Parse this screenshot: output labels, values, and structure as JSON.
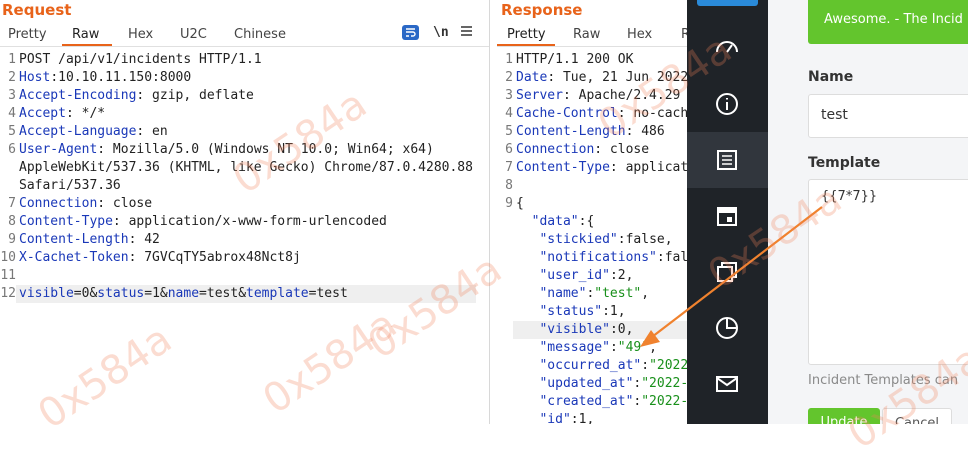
{
  "request": {
    "title": "Request",
    "tabs": [
      "Pretty",
      "Raw",
      "Hex",
      "U2C",
      "Chinese"
    ],
    "active_tab": "Raw",
    "icons": [
      "wrap-icon",
      "newline-icon",
      "menu-icon"
    ],
    "newline_label": "\\n",
    "lines": [
      {
        "n": "1",
        "parts": [
          [
            "p",
            "POST /api/v1/incidents HTTP/1.1"
          ]
        ]
      },
      {
        "n": "2",
        "parts": [
          [
            "k",
            "Host"
          ],
          [
            "p",
            ":10.10.11.150:8000"
          ]
        ]
      },
      {
        "n": "3",
        "parts": [
          [
            "k",
            "Accept-Encoding"
          ],
          [
            "p",
            ": gzip, deflate"
          ]
        ]
      },
      {
        "n": "4",
        "parts": [
          [
            "k",
            "Accept"
          ],
          [
            "p",
            ": */*"
          ]
        ]
      },
      {
        "n": "5",
        "parts": [
          [
            "k",
            "Accept-Language"
          ],
          [
            "p",
            ": en"
          ]
        ]
      },
      {
        "n": "6",
        "parts": [
          [
            "k",
            "User-Agent"
          ],
          [
            "p",
            ": Mozilla/5.0 (Windows NT 10.0; Win64; x64)"
          ]
        ]
      },
      {
        "n": "",
        "parts": [
          [
            "p",
            "AppleWebKit/537.36 (KHTML, like Gecko) Chrome/87.0.4280.88"
          ]
        ]
      },
      {
        "n": "",
        "parts": [
          [
            "p",
            "Safari/537.36"
          ]
        ]
      },
      {
        "n": "7",
        "parts": [
          [
            "k",
            "Connection"
          ],
          [
            "p",
            ": close"
          ]
        ]
      },
      {
        "n": "8",
        "parts": [
          [
            "k",
            "Content-Type"
          ],
          [
            "p",
            ": application/x-www-form-urlencoded"
          ]
        ]
      },
      {
        "n": "9",
        "parts": [
          [
            "k",
            "Content-Length"
          ],
          [
            "p",
            ": 42"
          ]
        ]
      },
      {
        "n": "10",
        "parts": [
          [
            "k",
            "X-Cachet-Token"
          ],
          [
            "p",
            ": 7GVCqTY5abrox48Nct8j"
          ]
        ]
      },
      {
        "n": "11",
        "parts": []
      },
      {
        "n": "12",
        "parts": [
          [
            "k",
            "visible"
          ],
          [
            "p",
            "="
          ],
          [
            "p",
            "0"
          ],
          [
            "p",
            "&"
          ],
          [
            "k",
            "status"
          ],
          [
            "p",
            "="
          ],
          [
            "p",
            "1"
          ],
          [
            "p",
            "&"
          ],
          [
            "k",
            "name"
          ],
          [
            "p",
            "="
          ],
          [
            "p",
            "test"
          ],
          [
            "p",
            "&"
          ],
          [
            "k",
            "template"
          ],
          [
            "p",
            "="
          ],
          [
            "p",
            "test"
          ]
        ]
      }
    ]
  },
  "response": {
    "title": "Response",
    "tabs": [
      "Pretty",
      "Raw",
      "Hex"
    ],
    "active_tab": "Pretty",
    "lines": [
      {
        "n": "1",
        "parts": [
          [
            "p",
            "HTTP/1.1 200 OK"
          ]
        ]
      },
      {
        "n": "2",
        "parts": [
          [
            "k",
            "Date"
          ],
          [
            "p",
            ": Tue, 21 Jun 2022 0"
          ]
        ]
      },
      {
        "n": "3",
        "parts": [
          [
            "k",
            "Server"
          ],
          [
            "p",
            ": Apache/2.4.29"
          ]
        ]
      },
      {
        "n": "4",
        "parts": [
          [
            "k",
            "Cache-Control"
          ],
          [
            "p",
            ": no-cach"
          ]
        ]
      },
      {
        "n": "5",
        "parts": [
          [
            "k",
            "Content-Length"
          ],
          [
            "p",
            ": 486"
          ]
        ]
      },
      {
        "n": "6",
        "parts": [
          [
            "k",
            "Connection"
          ],
          [
            "p",
            ": close"
          ]
        ]
      },
      {
        "n": "7",
        "parts": [
          [
            "k",
            "Content-Type"
          ],
          [
            "p",
            ": applicat"
          ]
        ]
      },
      {
        "n": "8",
        "parts": []
      },
      {
        "n": "9",
        "parts": [
          [
            "p",
            "{"
          ]
        ]
      },
      {
        "n": "",
        "parts": [
          [
            "p",
            "  "
          ],
          [
            "k",
            "\"data\""
          ],
          [
            "p",
            ":{"
          ]
        ]
      },
      {
        "n": "",
        "parts": [
          [
            "p",
            "   "
          ],
          [
            "k",
            "\"stickied\""
          ],
          [
            "p",
            ":false,"
          ]
        ]
      },
      {
        "n": "",
        "parts": [
          [
            "p",
            "   "
          ],
          [
            "k",
            "\"notifications\""
          ],
          [
            "p",
            ":fals"
          ]
        ]
      },
      {
        "n": "",
        "parts": [
          [
            "p",
            "   "
          ],
          [
            "k",
            "\"user_id\""
          ],
          [
            "p",
            ":2,"
          ]
        ]
      },
      {
        "n": "",
        "parts": [
          [
            "p",
            "   "
          ],
          [
            "k",
            "\"name\""
          ],
          [
            "p",
            ":"
          ],
          [
            "g",
            "\"test\""
          ],
          [
            "p",
            ","
          ]
        ]
      },
      {
        "n": "",
        "parts": [
          [
            "p",
            "   "
          ],
          [
            "k",
            "\"status\""
          ],
          [
            "p",
            ":1,"
          ]
        ]
      },
      {
        "n": "",
        "parts": [
          [
            "p",
            "   "
          ],
          [
            "k",
            "\"visible\""
          ],
          [
            "p",
            ":0,"
          ]
        ]
      },
      {
        "n": "",
        "parts": [
          [
            "p",
            "   "
          ],
          [
            "k",
            "\"message\""
          ],
          [
            "p",
            ":"
          ],
          [
            "g",
            "\"49\""
          ],
          [
            "p",
            ","
          ]
        ]
      },
      {
        "n": "",
        "parts": [
          [
            "p",
            "   "
          ],
          [
            "k",
            "\"occurred_at\""
          ],
          [
            "p",
            ":"
          ],
          [
            "g",
            "\"2022-"
          ]
        ]
      },
      {
        "n": "",
        "parts": [
          [
            "p",
            "   "
          ],
          [
            "k",
            "\"updated_at\""
          ],
          [
            "p",
            ":"
          ],
          [
            "g",
            "\"2022-("
          ]
        ]
      },
      {
        "n": "",
        "parts": [
          [
            "p",
            "   "
          ],
          [
            "k",
            "\"created_at\""
          ],
          [
            "p",
            ":"
          ],
          [
            "g",
            "\"2022-("
          ]
        ]
      },
      {
        "n": "",
        "parts": [
          [
            "p",
            "   "
          ],
          [
            "k",
            "\"id\""
          ],
          [
            "p",
            ":1,"
          ]
        ]
      }
    ]
  },
  "sidebar": {
    "icons": [
      "top-icon",
      "dashboard-icon",
      "info-icon",
      "incidents-icon",
      "calendar-icon",
      "components-icon",
      "metrics-icon",
      "subscribers-icon"
    ]
  },
  "form": {
    "alert": "Awesome. - The Incid",
    "name_label": "Name",
    "name_value": "test",
    "template_label": "Template",
    "template_value": "{{7*7}}",
    "hint": "Incident Templates can",
    "update_label": "Update",
    "cancel_label": "Cancel"
  },
  "watermark": "0x584a",
  "colors": {
    "accent": "#e8631a",
    "key": "#1a38b8",
    "string": "#19901b",
    "success": "#63c52d",
    "arrow": "#f0822e",
    "sidebar": "#1f2328"
  }
}
